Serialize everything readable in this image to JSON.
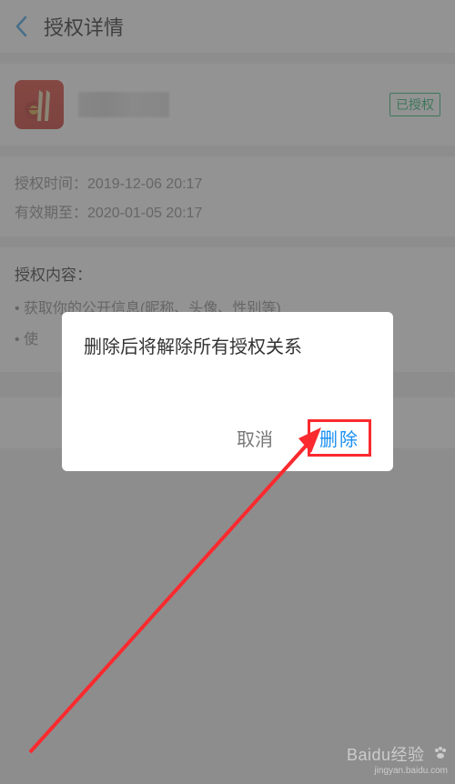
{
  "header": {
    "title": "授权详情"
  },
  "app": {
    "status_badge": "已授权"
  },
  "info": {
    "auth_time_label": "授权时间：",
    "auth_time_value": "2019-12-06 20:17",
    "valid_until_label": "有效期至：",
    "valid_until_value": "2020-01-05 20:17"
  },
  "content": {
    "title": "授权内容：",
    "items": [
      "• 获取你的公开信息(昵称、头像、性别等)",
      "• 使"
    ]
  },
  "dialog": {
    "message": "删除后将解除所有授权关系",
    "cancel_label": "取消",
    "delete_label": "删除"
  },
  "watermark": {
    "brand": "Baidu",
    "product": "经验",
    "url": "jingyan.baidu.com"
  }
}
